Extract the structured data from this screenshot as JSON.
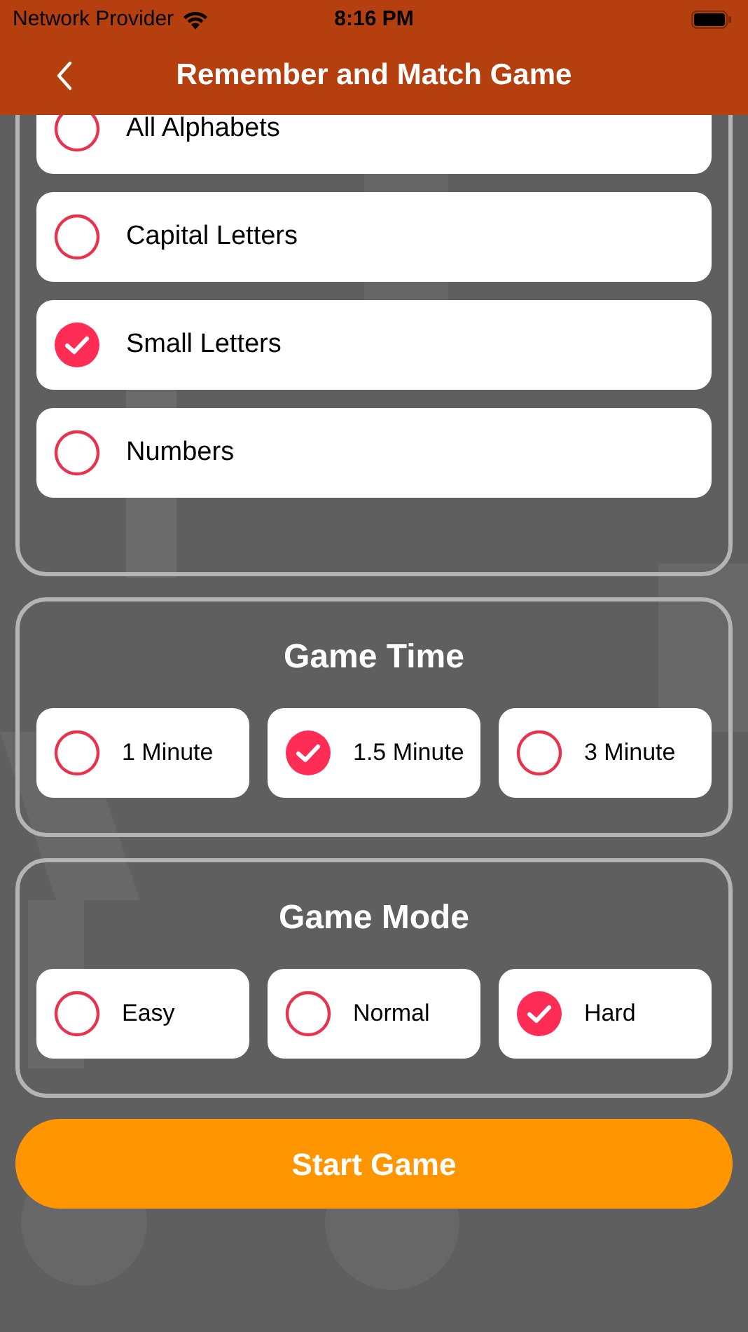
{
  "status_bar": {
    "carrier": "Network Provider",
    "time": "8:16 PM"
  },
  "nav": {
    "title": "Remember and Match Game"
  },
  "sections": [
    {
      "kind": "list",
      "options": [
        {
          "label": "All Alphabets",
          "selected": false
        },
        {
          "label": "Capital Letters",
          "selected": false
        },
        {
          "label": "Small Letters",
          "selected": true
        },
        {
          "label": "Numbers",
          "selected": false
        }
      ]
    },
    {
      "kind": "grid",
      "title": "Game Time",
      "options": [
        {
          "label": "1 Minute",
          "selected": false
        },
        {
          "label": "1.5 Minute",
          "selected": true
        },
        {
          "label": "3 Minute",
          "selected": false
        }
      ]
    },
    {
      "kind": "grid",
      "title": "Game Mode",
      "options": [
        {
          "label": "Easy",
          "selected": false
        },
        {
          "label": "Normal",
          "selected": false
        },
        {
          "label": "Hard",
          "selected": true
        }
      ]
    }
  ],
  "start_button": "Start Game"
}
